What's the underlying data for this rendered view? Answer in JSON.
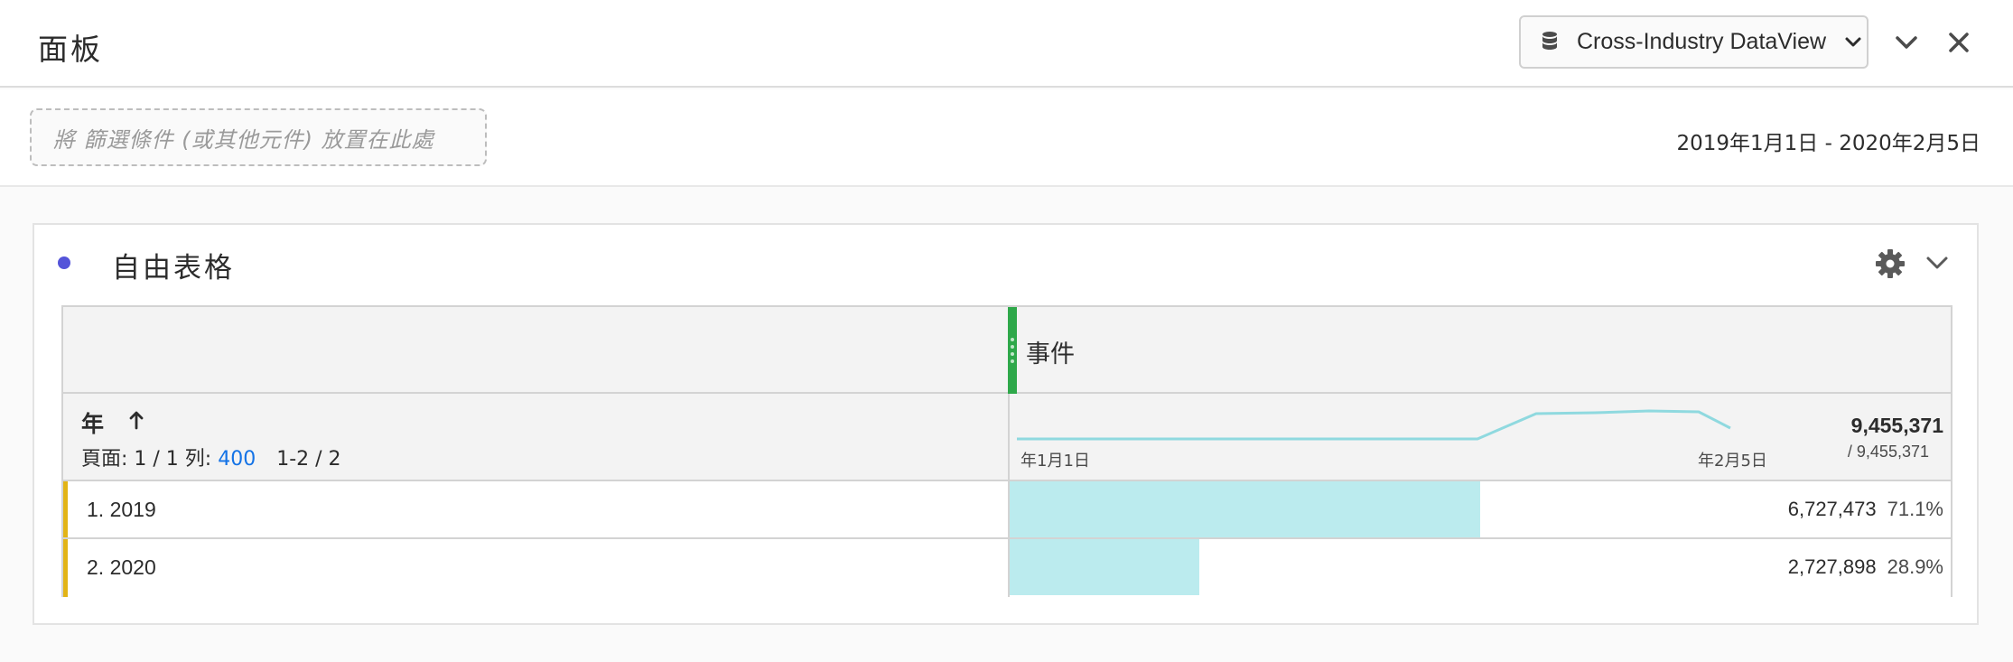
{
  "header": {
    "title": "面板",
    "dataview": "Cross-Industry DataView"
  },
  "filter": {
    "placeholder": "將 篩選條件 (或其他元件) 放置在此處",
    "date_range": "2019年1月1日 - 2020年2月5日"
  },
  "panel": {
    "name": "自由表格",
    "dot_color": "#5454d9"
  },
  "table": {
    "metric": "事件",
    "dimension": "年",
    "page_label": "頁面: 1 / 1 列:",
    "rows_per_page": "400",
    "range": "1-2 / 2",
    "sparkline": {
      "start_label": "年1月1日",
      "end_label": "年2月5日",
      "color": "#8fd9df"
    },
    "total": "9,455,371",
    "total_sub": "/ 9,455,371",
    "rows": [
      {
        "label": "1. 2019",
        "value": "6,727,473",
        "pct": "71.1%",
        "fraction": 0.711
      },
      {
        "label": "2. 2020",
        "value": "2,727,898",
        "pct": "28.9%",
        "fraction": 0.289
      }
    ],
    "bar_color": "#bbebee",
    "row_marker_color": "#e2b416"
  }
}
